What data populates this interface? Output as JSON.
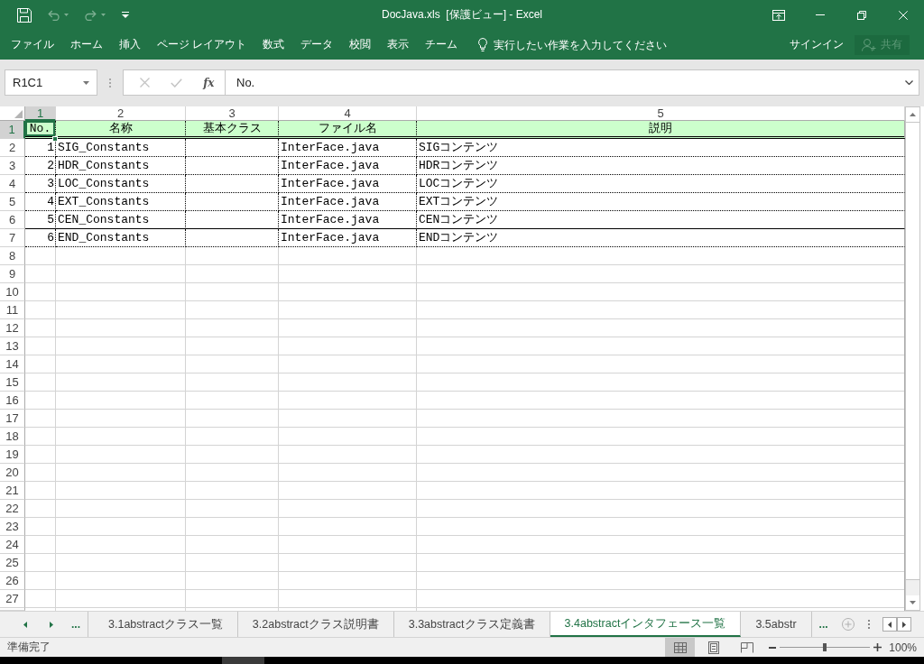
{
  "window": {
    "title": "DocJava.xls  [保護ビュー] - Excel"
  },
  "quick_access": [
    {
      "kind": "save",
      "disabled": false
    },
    {
      "kind": "undo",
      "disabled": true
    },
    {
      "kind": "redo",
      "disabled": true
    },
    {
      "kind": "customize",
      "disabled": false
    }
  ],
  "ribbon": {
    "tabs": [
      {
        "label": "ファイル",
        "selected": false
      },
      {
        "label": "ホーム",
        "selected": false
      },
      {
        "label": "挿入",
        "selected": false
      },
      {
        "label": "ページ レイアウト",
        "selected": false
      },
      {
        "label": "数式",
        "selected": false
      },
      {
        "label": "データ",
        "selected": false
      },
      {
        "label": "校閲",
        "selected": false
      },
      {
        "label": "表示",
        "selected": false
      },
      {
        "label": "チーム",
        "selected": false
      }
    ],
    "tell_me": {
      "placeholder": "実行したい作業を入力してください"
    },
    "sign_in": "サインイン",
    "share": {
      "label": "共有",
      "disabled": true
    }
  },
  "formula_bar": {
    "name_box": "R1C1",
    "buttons": [
      {
        "kind": "cancel",
        "disabled": true
      },
      {
        "kind": "enter",
        "disabled": true
      },
      {
        "kind": "function",
        "label": "fx",
        "disabled": false
      }
    ],
    "value": "No."
  },
  "sheet": {
    "columns": [
      {
        "label": "1",
        "selected": true
      },
      {
        "label": "2",
        "selected": false
      },
      {
        "label": "3",
        "selected": false
      },
      {
        "label": "4",
        "selected": false
      },
      {
        "label": "5",
        "selected": false
      }
    ],
    "rows": [
      {
        "number": "1",
        "selected": true,
        "kind": "header",
        "cells": [
          {
            "text": "No.",
            "active": true
          },
          {
            "text": "名称",
            "active": false
          },
          {
            "text": "基本クラス",
            "active": false
          },
          {
            "text": "ファイル名",
            "active": false
          },
          {
            "text": "説明",
            "active": false
          }
        ]
      },
      {
        "number": "2",
        "selected": false,
        "kind": "data",
        "solid_border_below": false,
        "cells": [
          {
            "text": "1",
            "active": false
          },
          {
            "text": "SIG_Constants",
            "active": false
          },
          {
            "active": false
          },
          {
            "text": "InterFace.java",
            "active": false
          },
          {
            "text": "SIGコンテンツ",
            "active": false
          }
        ]
      },
      {
        "number": "3",
        "selected": false,
        "kind": "data",
        "solid_border_below": false,
        "cells": [
          {
            "text": "2",
            "active": false
          },
          {
            "text": "HDR_Constants",
            "active": false
          },
          {
            "active": false
          },
          {
            "text": "InterFace.java",
            "active": false
          },
          {
            "text": "HDRコンテンツ",
            "active": false
          }
        ]
      },
      {
        "number": "4",
        "selected": false,
        "kind": "data",
        "solid_border_below": false,
        "cells": [
          {
            "text": "3",
            "active": false
          },
          {
            "text": "LOC_Constants",
            "active": false
          },
          {
            "active": false
          },
          {
            "text": "InterFace.java",
            "active": false
          },
          {
            "text": "LOCコンテンツ",
            "active": false
          }
        ]
      },
      {
        "number": "5",
        "selected": false,
        "kind": "data",
        "solid_border_below": false,
        "cells": [
          {
            "text": "4",
            "active": false
          },
          {
            "text": "EXT_Constants",
            "active": false
          },
          {
            "active": false
          },
          {
            "text": "InterFace.java",
            "active": false
          },
          {
            "text": "EXTコンテンツ",
            "active": false
          }
        ]
      },
      {
        "number": "6",
        "selected": false,
        "kind": "data",
        "solid_border_below": true,
        "cells": [
          {
            "text": "5",
            "active": false
          },
          {
            "text": "CEN_Constants",
            "active": false
          },
          {
            "active": false
          },
          {
            "text": "InterFace.java",
            "active": false
          },
          {
            "text": "CENコンテンツ",
            "active": false
          }
        ]
      },
      {
        "number": "7",
        "selected": false,
        "kind": "data",
        "solid_border_below": false,
        "cells": [
          {
            "text": "6",
            "active": false
          },
          {
            "text": "END_Constants",
            "active": false
          },
          {
            "active": false
          },
          {
            "text": "InterFace.java",
            "active": false
          },
          {
            "text": "ENDコンテンツ",
            "active": false
          }
        ]
      },
      {
        "number": "8",
        "selected": false,
        "kind": "empty"
      },
      {
        "number": "9",
        "selected": false,
        "kind": "empty"
      },
      {
        "number": "10",
        "selected": false,
        "kind": "empty"
      },
      {
        "number": "11",
        "selected": false,
        "kind": "empty"
      },
      {
        "number": "12",
        "selected": false,
        "kind": "empty"
      },
      {
        "number": "13",
        "selected": false,
        "kind": "empty"
      },
      {
        "number": "14",
        "selected": false,
        "kind": "empty"
      },
      {
        "number": "15",
        "selected": false,
        "kind": "empty"
      },
      {
        "number": "16",
        "selected": false,
        "kind": "empty"
      },
      {
        "number": "17",
        "selected": false,
        "kind": "empty"
      },
      {
        "number": "18",
        "selected": false,
        "kind": "empty"
      },
      {
        "number": "19",
        "selected": false,
        "kind": "empty"
      },
      {
        "number": "20",
        "selected": false,
        "kind": "empty"
      },
      {
        "number": "21",
        "selected": false,
        "kind": "empty"
      },
      {
        "number": "22",
        "selected": false,
        "kind": "empty"
      },
      {
        "number": "23",
        "selected": false,
        "kind": "empty"
      },
      {
        "number": "24",
        "selected": false,
        "kind": "empty"
      },
      {
        "number": "25",
        "selected": false,
        "kind": "empty"
      },
      {
        "number": "26",
        "selected": false,
        "kind": "empty"
      },
      {
        "number": "27",
        "selected": false,
        "kind": "empty"
      }
    ]
  },
  "sheet_tabs": {
    "overflow_left": "...",
    "tabs": [
      {
        "label": "3.1abstractクラス一覧",
        "selected": false
      },
      {
        "label": "3.2abstractクラス説明書",
        "selected": false
      },
      {
        "label": "3.3abstractクラス定義書",
        "selected": false
      },
      {
        "label": "3.4abstractインタフェース一覧",
        "selected": true
      },
      {
        "label": "3.5abstr",
        "selected": false
      }
    ],
    "overflow_right": "..."
  },
  "status_bar": {
    "text": "準備完了",
    "views": [
      {
        "kind": "normal",
        "selected": true
      },
      {
        "kind": "page_layout",
        "selected": false
      },
      {
        "kind": "page_break",
        "selected": false
      }
    ],
    "zoom": {
      "level": 0.5,
      "reading": "100%"
    }
  }
}
